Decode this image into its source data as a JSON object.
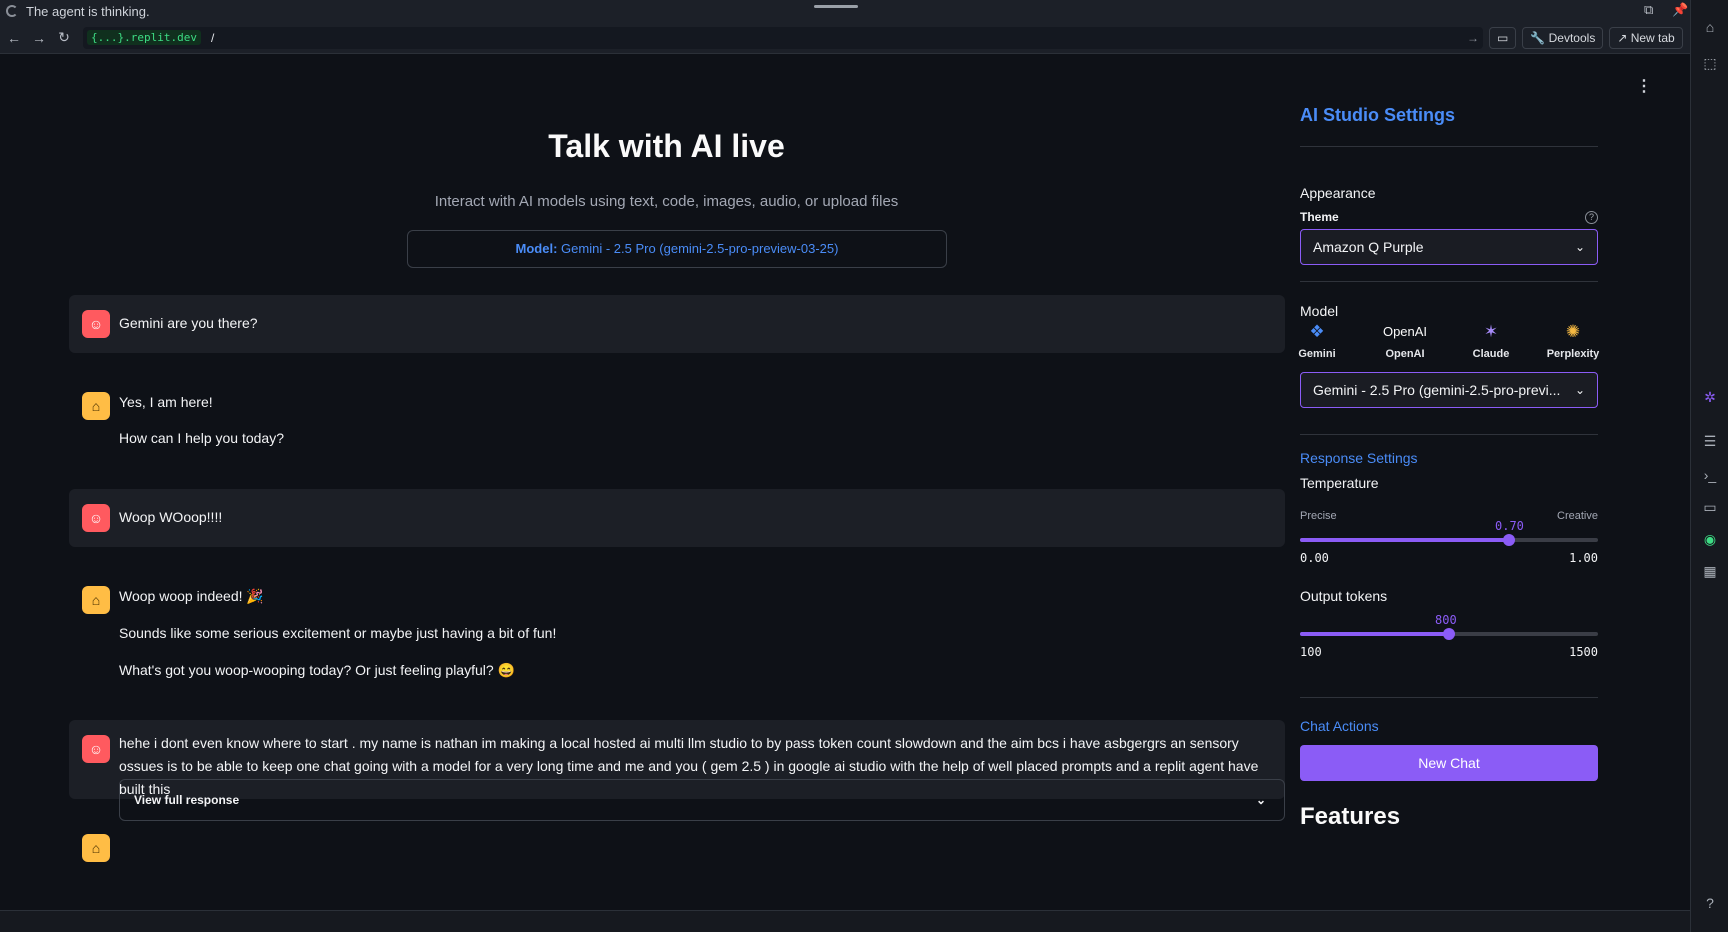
{
  "topbar": {
    "status": "The agent is thinking."
  },
  "address": {
    "host": "{...}.replit.dev",
    "path": "/",
    "devtools": "Devtools",
    "newtab": "New tab"
  },
  "header": {
    "title": "Talk with AI live",
    "subtitle": "Interact with AI models using text, code, images, audio, or upload files",
    "model_label": "Model:",
    "model_value": "Gemini - 2.5 Pro (gemini-2.5-pro-preview-03-25)"
  },
  "messages": [
    {
      "role": "user",
      "lines": [
        "Gemini are you there?"
      ]
    },
    {
      "role": "assistant",
      "lines": [
        "Yes, I am here!",
        "How can I help you today?"
      ]
    },
    {
      "role": "user",
      "lines": [
        "Woop WOoop!!!!"
      ]
    },
    {
      "role": "assistant",
      "lines": [
        "Woop woop indeed! 🎉",
        "Sounds like some serious excitement or maybe just having a bit of fun!",
        "What's got you woop-wooping today? Or just feeling playful? 😄"
      ]
    },
    {
      "role": "user",
      "lines": [
        "hehe i dont even know where to start . my name is nathan im making a local hosted ai multi llm studio to by pass token count slowdown and the aim bcs i have asbgergrs an sensory ossues is to be able to keep one chat going with a model for a very long time and me and you ( gem 2.5 ) in google ai studio with the help of well placed prompts and a replit agent have built this"
      ]
    }
  ],
  "expander": {
    "label": "View full response"
  },
  "sidebar": {
    "title": "AI Studio Settings",
    "appearance": "Appearance",
    "theme_label": "Theme",
    "theme_value": "Amazon Q Purple",
    "model_heading": "Model",
    "providers": [
      "Gemini",
      "OpenAI",
      "Claude",
      "Perplexity"
    ],
    "openai_img_alt": "OpenAI",
    "model_select": "Gemini - 2.5 Pro (gemini-2.5-pro-previ...",
    "response_settings": "Response Settings",
    "temperature": {
      "label": "Temperature",
      "left": "Precise",
      "right": "Creative",
      "value": "0.70",
      "min": "0.00",
      "max": "1.00",
      "fraction": 0.7
    },
    "tokens": {
      "label": "Output tokens",
      "value": "800",
      "min": "100",
      "max": "1500",
      "fraction": 0.5
    },
    "chat_actions": "Chat Actions",
    "new_chat": "New Chat",
    "features": "Features"
  },
  "colors": {
    "accent": "#8b5cf6",
    "link": "#4a8cf7",
    "user_avatar": "#ff5a5f",
    "bot_avatar": "#ffbd45"
  }
}
